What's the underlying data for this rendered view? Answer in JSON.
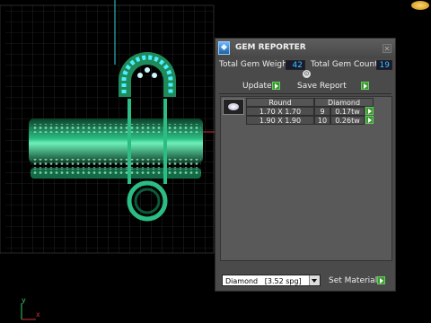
{
  "window": {
    "title": "GEM REPORTER"
  },
  "totals": {
    "weight_label": "Total Gem Weight",
    "weight_value": "42",
    "count_label": "Total Gem Count",
    "count_value": "19"
  },
  "actions": {
    "update_label": "Update",
    "save_label": "Save Report"
  },
  "table": {
    "headers": [
      "Round",
      "Diamond"
    ],
    "rows": [
      {
        "size": "1.70 X 1.70",
        "count": "9",
        "weight": "0.17tw"
      },
      {
        "size": "1.90 X 1.90",
        "count": "10",
        "weight": "0.26tw"
      }
    ]
  },
  "footer": {
    "material_selected": "Diamond   [3.52 spg]",
    "set_material_label": "Set Material"
  },
  "axes": {
    "y_label": "y",
    "x_label": "x"
  },
  "colors": {
    "accent_cyan": "#36c7ff",
    "button_green": "#3a9a2a",
    "model_green": "#1f8a5a"
  }
}
